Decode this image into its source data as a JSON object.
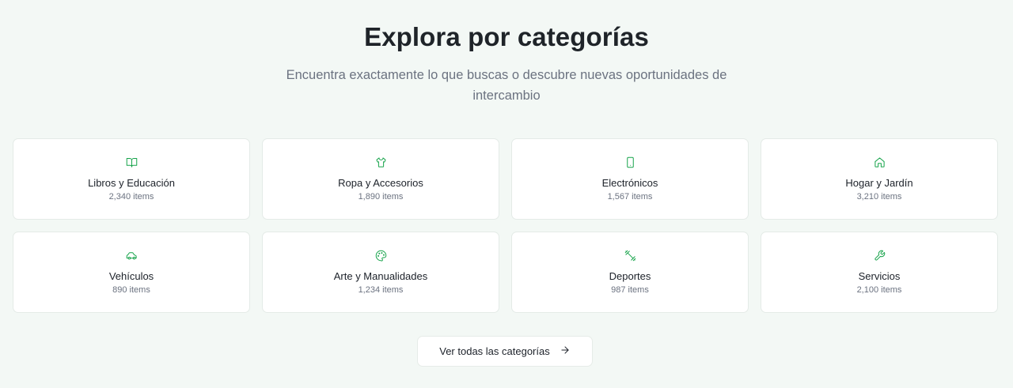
{
  "header": {
    "title": "Explora por categorías",
    "subtitle": "Encuentra exactamente lo que buscas o descubre nuevas oportunidades de intercambio"
  },
  "categories": [
    {
      "name": "Libros y Educación",
      "count": "2,340 items",
      "icon": "book-icon"
    },
    {
      "name": "Ropa y Accesorios",
      "count": "1,890 items",
      "icon": "shirt-icon"
    },
    {
      "name": "Electrónicos",
      "count": "1,567 items",
      "icon": "smartphone-icon"
    },
    {
      "name": "Hogar y Jardín",
      "count": "3,210 items",
      "icon": "home-icon"
    },
    {
      "name": "Vehículos",
      "count": "890 items",
      "icon": "car-icon"
    },
    {
      "name": "Arte y Manualidades",
      "count": "1,234 items",
      "icon": "palette-icon"
    },
    {
      "name": "Deportes",
      "count": "987 items",
      "icon": "dumbbell-icon"
    },
    {
      "name": "Servicios",
      "count": "2,100 items",
      "icon": "wrench-icon"
    }
  ],
  "cta": {
    "label": "Ver todas las categorías",
    "icon": "arrow-right-icon"
  },
  "colors": {
    "accent": "#16a34a",
    "background": "#f3f8f5"
  }
}
